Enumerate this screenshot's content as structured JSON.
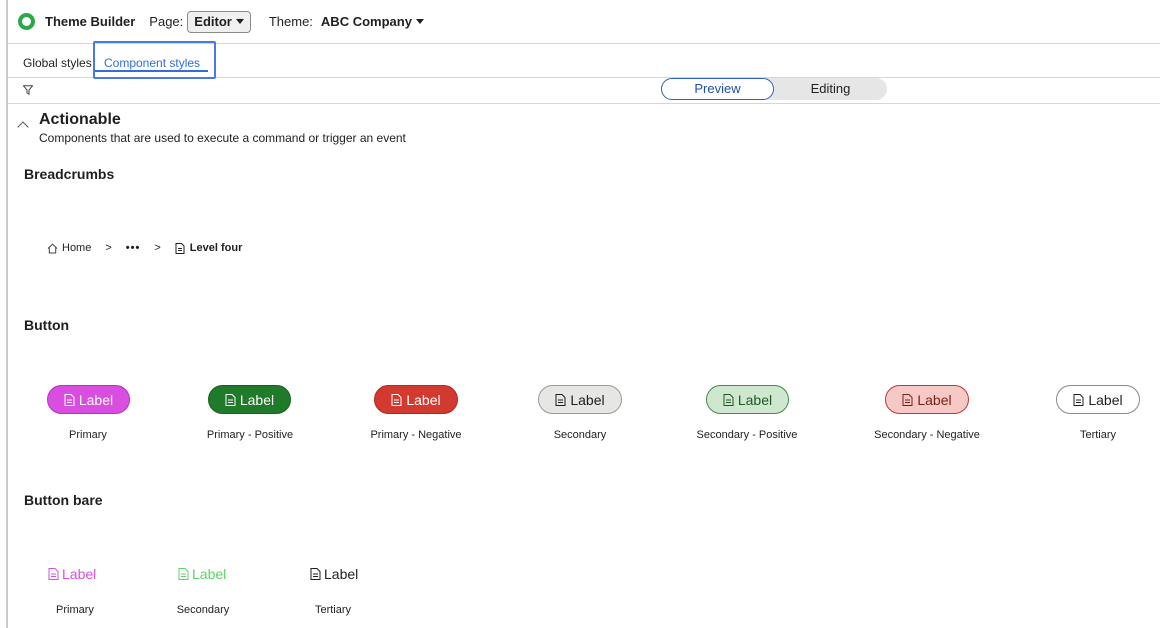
{
  "header": {
    "app_title": "Theme Builder",
    "page_label": "Page:",
    "page_value": "Editor",
    "theme_label": "Theme:",
    "theme_value": "ABC Company"
  },
  "tabs": [
    {
      "label": "Global styles",
      "active": false
    },
    {
      "label": "Component styles",
      "active": true
    }
  ],
  "view_toggle": {
    "preview": "Preview",
    "editing": "Editing",
    "selected": "Preview"
  },
  "section": {
    "title": "Actionable",
    "description": "Components that are used to execute a command or trigger an event"
  },
  "breadcrumbs": {
    "heading": "Breadcrumbs",
    "home": "Home",
    "separator": ">",
    "ellipsis": "•••",
    "current": "Level four"
  },
  "buttons": {
    "heading": "Button",
    "items": [
      {
        "label": "Label",
        "caption": "Primary",
        "color": "#d94ee0"
      },
      {
        "label": "Label",
        "caption": "Primary - Positive",
        "color": "#1f7a2a"
      },
      {
        "label": "Label",
        "caption": "Primary - Negative",
        "color": "#d33a2f"
      },
      {
        "label": "Label",
        "caption": "Secondary",
        "color": "#e6e6e2"
      },
      {
        "label": "Label",
        "caption": "Secondary - Positive",
        "color": "#cfe7cf"
      },
      {
        "label": "Label",
        "caption": "Secondary - Negative",
        "color": "#f6c9c6"
      },
      {
        "label": "Label",
        "caption": "Tertiary",
        "color": "#ffffff"
      }
    ]
  },
  "bare_buttons": {
    "heading": "Button bare",
    "items": [
      {
        "label": "Label",
        "caption": "Primary",
        "color": "#d94ee0"
      },
      {
        "label": "Label",
        "caption": "Secondary",
        "color": "#5fd36a"
      },
      {
        "label": "Label",
        "caption": "Tertiary",
        "color": "#1f1f1f"
      }
    ]
  },
  "icons": {
    "logo": "theme-builder-logo",
    "filter": "filter-icon",
    "collapse": "chevron-up-icon",
    "home": "home-icon",
    "document": "document-icon"
  }
}
